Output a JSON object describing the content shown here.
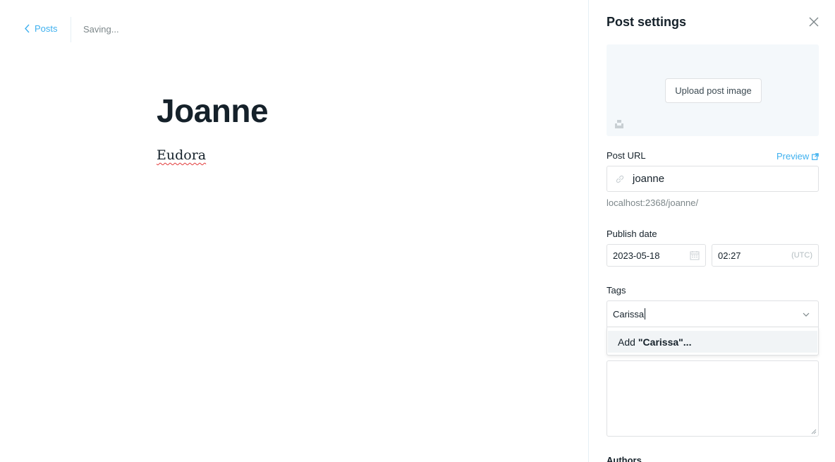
{
  "header": {
    "back_label": "Posts",
    "save_status": "Saving..."
  },
  "editor": {
    "title": "Joanne",
    "body": "Eudora"
  },
  "settings": {
    "title": "Post settings",
    "upload_label": "Upload post image",
    "post_url": {
      "label": "Post URL",
      "preview_label": "Preview",
      "value": "joanne",
      "hint": "localhost:2368/joanne/"
    },
    "publish_date": {
      "label": "Publish date",
      "date": "2023-05-18",
      "time": "02:27",
      "timezone": "(UTC)"
    },
    "tags": {
      "label": "Tags",
      "value": "Carissa",
      "option_prefix": "Add",
      "option_value": "\"Carissa\"..."
    },
    "authors_label": "Authors"
  },
  "colors": {
    "accent": "#3eb0ef",
    "text": "#15212a",
    "muted": "#7d878a",
    "border": "#dfe1e3"
  }
}
